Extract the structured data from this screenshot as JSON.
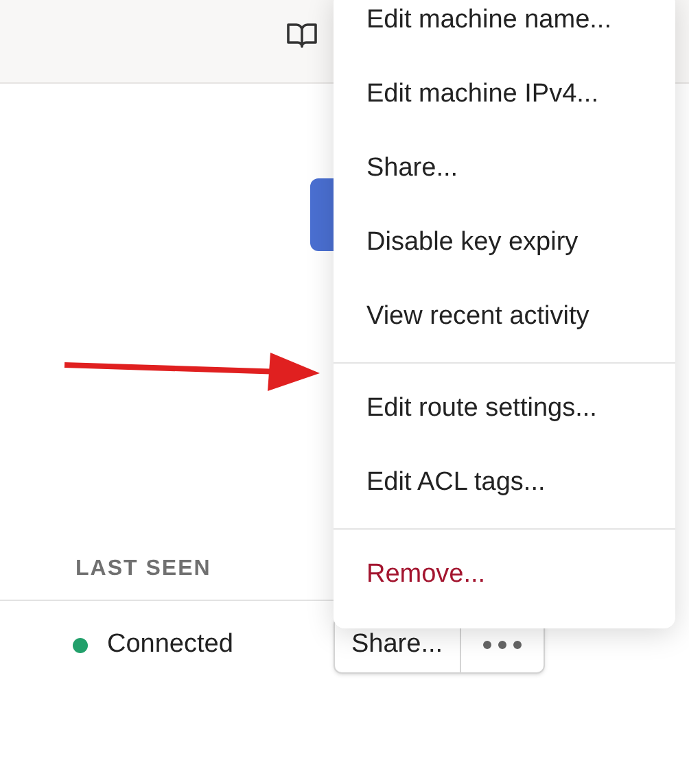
{
  "menu": {
    "groups": [
      [
        {
          "label": "Edit machine name...",
          "kind": "item"
        },
        {
          "label": "Edit machine IPv4...",
          "kind": "item"
        },
        {
          "label": "Share...",
          "kind": "item"
        },
        {
          "label": "Disable key expiry",
          "kind": "item"
        },
        {
          "label": "View recent activity",
          "kind": "item"
        }
      ],
      [
        {
          "label": "Edit route settings...",
          "kind": "item"
        },
        {
          "label": "Edit ACL tags...",
          "kind": "item"
        }
      ],
      [
        {
          "label": "Remove...",
          "kind": "danger"
        }
      ]
    ]
  },
  "table": {
    "columns": [
      "LAST SEEN"
    ],
    "rows": [
      {
        "status": "Connected",
        "color": "#22a06b",
        "share": "Share..."
      }
    ]
  }
}
